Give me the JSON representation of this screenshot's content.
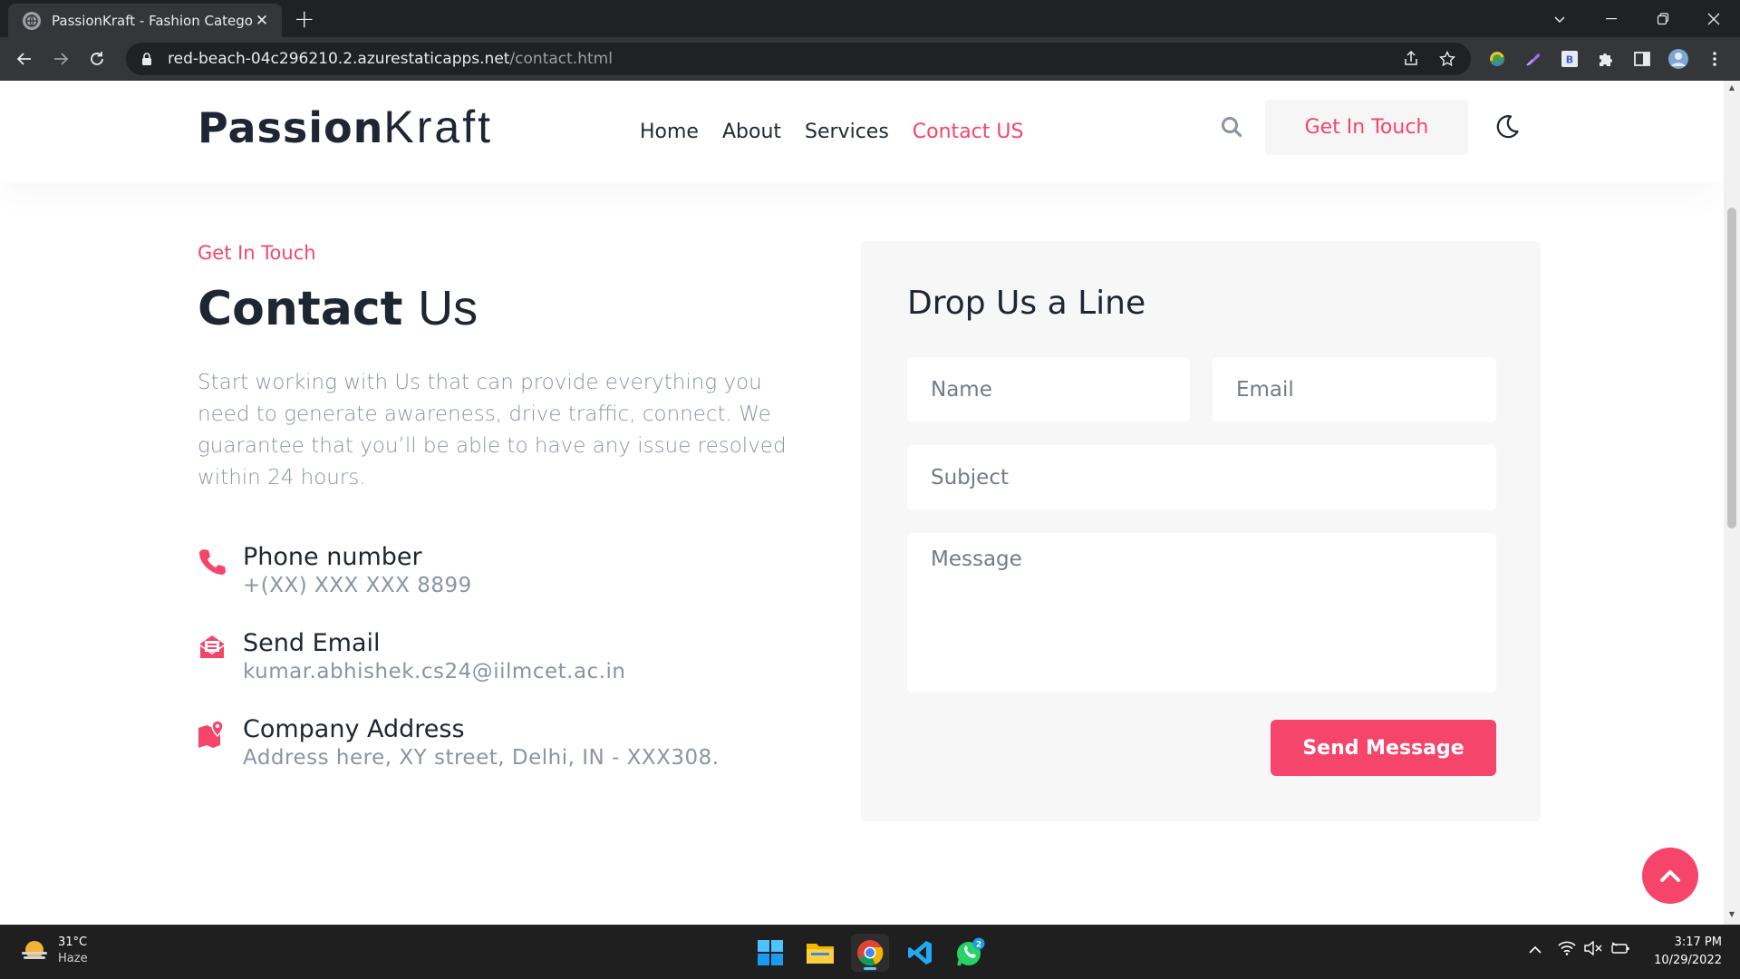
{
  "browser": {
    "tab_title": "PassionKraft - Fashion Category",
    "tab_close": "✕",
    "new_tab": "+",
    "url_host": "red-beach-04c296210.2.azurestaticapps.net",
    "url_path": "/contact.html"
  },
  "header": {
    "logo_strong": "Passion",
    "logo_light": "Kraft",
    "nav": [
      {
        "label": "Home"
      },
      {
        "label": "About"
      },
      {
        "label": "Services"
      },
      {
        "label": "Contact US"
      }
    ],
    "cta_label": "Get In Touch"
  },
  "contact": {
    "label": "Get In Touch",
    "title_strong": "Contact",
    "title_light": "Us",
    "intro": "Start working with Us that can provide everything you need to generate awareness, drive traffic, connect. We guarantee that you’ll be able to have any issue resolved within 24 hours.",
    "items": [
      {
        "heading": "Phone number",
        "value": "+(XX) XXX XXX 8899",
        "icon": "phone-icon"
      },
      {
        "heading": "Send Email",
        "value": "kumar.abhishek.cs24@iilmcet.ac.in",
        "icon": "email-icon"
      },
      {
        "heading": "Company Address",
        "value": "Address here, XY street, Delhi, IN - XXX308.",
        "icon": "map-icon"
      }
    ]
  },
  "form": {
    "title": "Drop Us a Line",
    "name_placeholder": "Name",
    "email_placeholder": "Email",
    "subject_placeholder": "Subject",
    "message_placeholder": "Message",
    "submit_label": "Send Message"
  },
  "taskbar": {
    "temperature": "31°C",
    "condition": "Haze",
    "time": "3:17 PM",
    "date": "10/29/2022",
    "whatsapp_badge": "2"
  },
  "colors": {
    "accent": "#f5456b",
    "heading": "#1e2533",
    "muted": "#8a94a3",
    "card_bg": "#f7f7f7"
  }
}
